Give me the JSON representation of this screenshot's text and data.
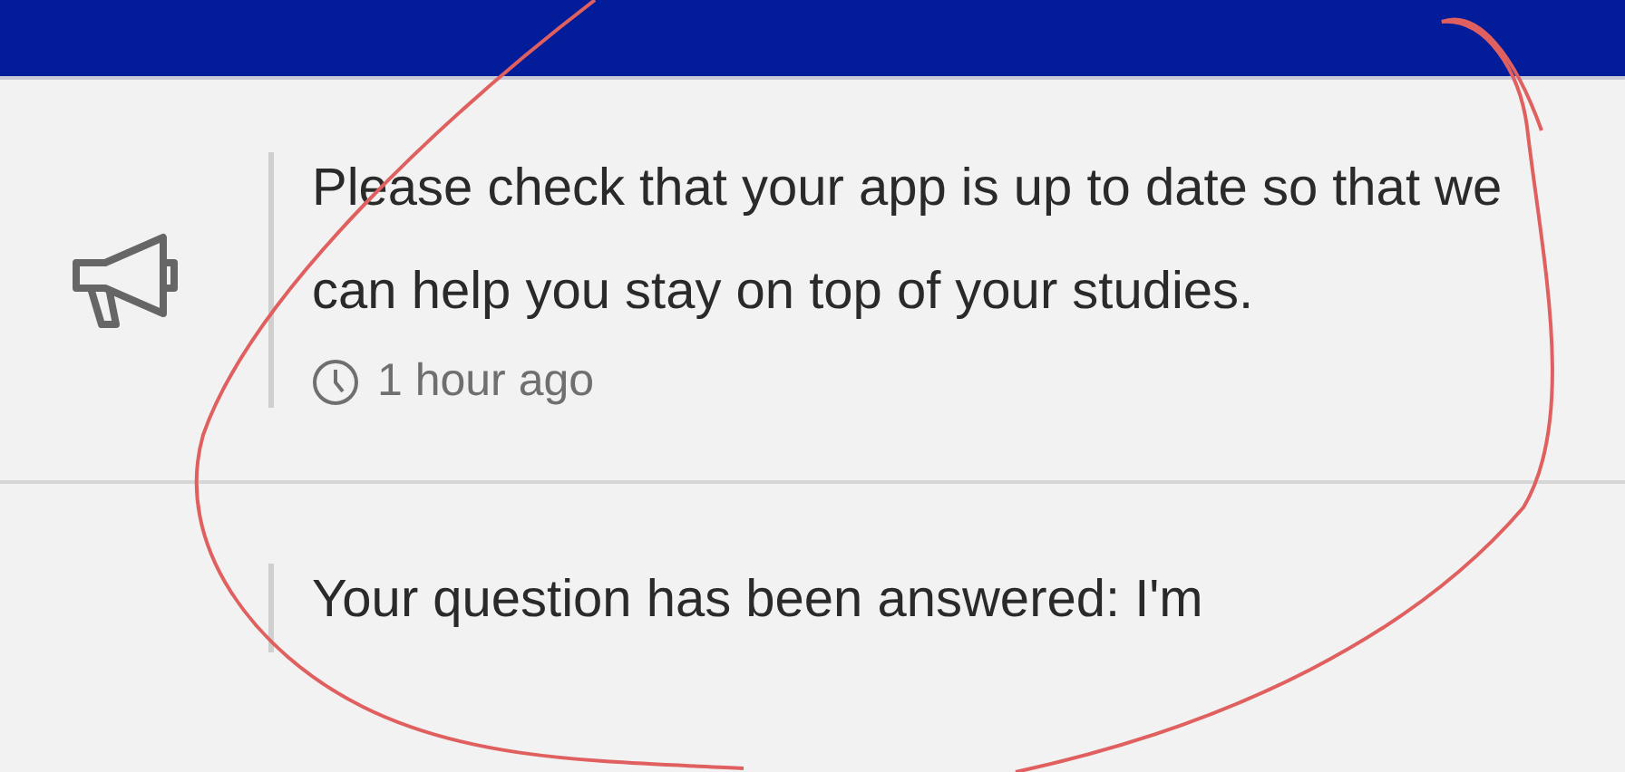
{
  "notifications": [
    {
      "kind": "announcement",
      "text": "Please check that your app is up to date so that we can help you stay on top of your studies.",
      "time": "1 hour ago"
    },
    {
      "kind": "answer",
      "text": "Your question has been answered: I'm"
    }
  ]
}
